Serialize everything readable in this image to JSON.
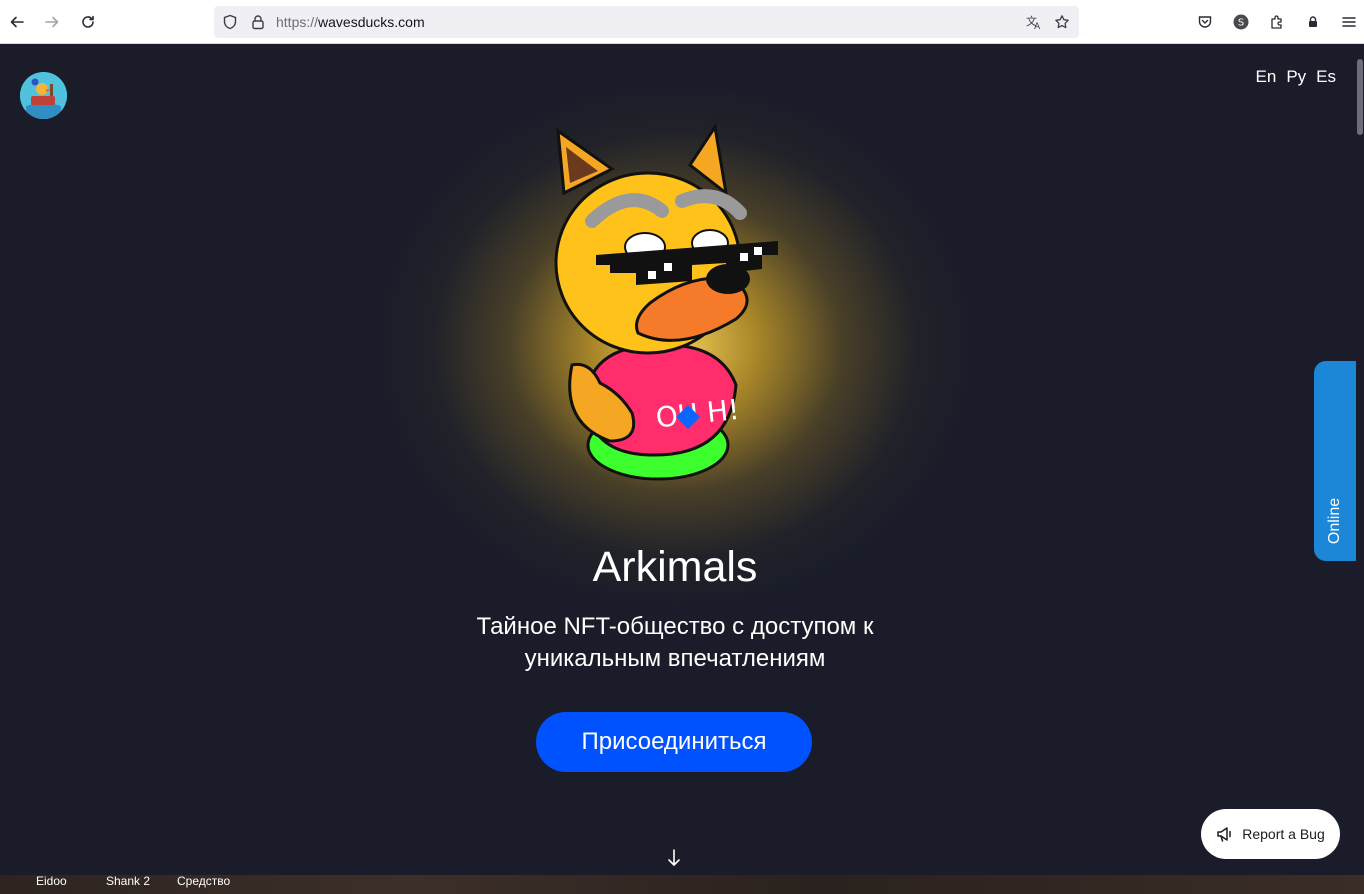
{
  "browser": {
    "url_scheme": "https://",
    "url_host": "wavesducks.com",
    "back_icon": "arrow-left",
    "forward_icon": "arrow-right",
    "reload_icon": "reload",
    "profile_initial": "S"
  },
  "header": {
    "languages": [
      "En",
      "Ру",
      "Es"
    ]
  },
  "hero": {
    "title": "Arkimals",
    "subtitle": "Тайное NFT-общество с доступом к уникальным впечатлениям",
    "join_label": "Присоединиться",
    "shirt_text": "OU H!"
  },
  "online_tab": {
    "label": "Online"
  },
  "report_bug": {
    "label": "Report a Bug"
  },
  "scroll": {
    "arrow": "↓"
  },
  "taskbar": {
    "items": [
      "Eidoo",
      "Shank 2",
      "Средство"
    ]
  },
  "colors": {
    "page_bg": "#1a1d29",
    "join_button": "#0052ff",
    "online_tab": "#1b87d6",
    "glow": "#ffd65a"
  }
}
